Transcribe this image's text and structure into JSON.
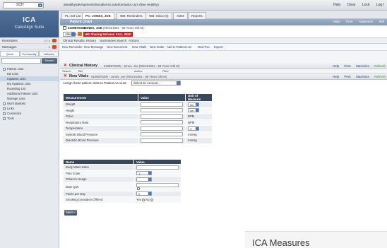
{
  "topbar": {
    "site_select": "SCH",
    "url": "ahealthy\\devlopment\\clinicalterms.icainformatics.com (Bee Healthy)",
    "links": [
      "Help",
      "Clear",
      "Lock",
      "Log I"
    ]
  },
  "sidebar": {
    "logo": "ICA",
    "suite": "CareAlign Suite",
    "rows": [
      {
        "label": "Reminders",
        "count": "0 / 0"
      },
      {
        "label": "Messages",
        "count": "0"
      }
    ],
    "tabs": [
      "Quick",
      "Community",
      "Network"
    ],
    "search_btn": "Search",
    "tree": [
      {
        "label": "Patient Lists",
        "sub": false,
        "selected": false
      },
      {
        "label": "ED Lists",
        "sub": true,
        "selected": false
      },
      {
        "label": "Inpatient Lists",
        "sub": true,
        "selected": true
      },
      {
        "label": "My Inpatient Lists",
        "sub": true,
        "selected": false
      },
      {
        "label": "Rounding List",
        "sub": true,
        "selected": false
      },
      {
        "label": "Additional Patient Lists",
        "sub": true,
        "selected": false
      },
      {
        "label": "Manage Lists",
        "sub": true,
        "selected": false
      },
      {
        "label": "Work Baskets",
        "sub": false,
        "selected": false
      },
      {
        "label": "Links",
        "sub": false,
        "selected": false
      },
      {
        "label": "Customize",
        "sub": false,
        "selected": false
      },
      {
        "label": "Tools",
        "sub": false,
        "selected": false
      }
    ]
  },
  "main": {
    "tabs": [
      "PL: ED List",
      "PC: JONES, JOE",
      "WB: Reminders",
      "WB: Inbox (0)",
      "ADM:",
      "Reports"
    ],
    "patient_chart": {
      "title": "Patient Chart",
      "links": [
        "Help",
        "Print",
        "Maximize",
        "Ref"
      ]
    },
    "patient": {
      "mrn": "5109870205",
      "name": "JONES, JOE",
      "dob": "(09/24/1951 - 58 Years Old M)"
    },
    "alerts": {
      "select": "Allergies",
      "badges": [
        "HIE Sharing Refused",
        "FALL RISK"
      ]
    },
    "subtabs": [
      "Clinical Results",
      "History",
      "Summaries",
      "Search",
      "Actions"
    ],
    "actions": [
      "New Reminder",
      "New Message",
      "New Document",
      "New Vitals",
      "New Order",
      "Add to Patient List",
      "Med Rec",
      "Export"
    ],
    "clinical_history": {
      "title": "Clinical History",
      "subtitle": "5109870205 - Jones, Joe (09/24/1951 - 58 Years Old M)",
      "links": [
        "Help",
        "Print",
        "Maximize",
        "Refresh"
      ],
      "cols": [
        "Search",
        "Title",
        "Author",
        "Filter"
      ]
    },
    "new_vitals": {
      "title": "New Vitals",
      "subtitle": "5109870205 - Jones, Joe (09/24/1951 - 58 Years Old M)",
      "links": [
        "Help",
        "Print",
        "Maximize",
        "Refresh"
      ],
      "assign_label": "Assign these patient vitals to Patient Account:",
      "assign_select": "Select an Account..."
    },
    "measurements": {
      "headers": [
        "Measurement",
        "Value",
        "Unit of Measure"
      ],
      "rows": [
        {
          "name": "Weight",
          "unit": "lbs",
          "unit_dd": true
        },
        {
          "name": "Height",
          "unit": "cm",
          "unit_dd": true
        },
        {
          "name": "Pulse",
          "unit": "BPM",
          "unit_dd": false
        },
        {
          "name": "Respiratory Rate",
          "unit": "BPM",
          "unit_dd": false
        },
        {
          "name": "Temperature",
          "unit": "C",
          "unit_dd": true
        },
        {
          "name": "Systolic Blood Pressure",
          "unit": "mmHg",
          "unit_dd": false
        },
        {
          "name": "Diastolic Blood Pressure",
          "unit": "mmHg",
          "unit_dd": false
        }
      ]
    },
    "other": {
      "headers": [
        "Name",
        "Value"
      ],
      "rows": [
        {
          "name": "Body Mass Index",
          "kind": "text",
          "value": ""
        },
        {
          "name": "Pain Scale",
          "kind": "select",
          "value": "1"
        },
        {
          "name": "Tobacco Usage",
          "kind": "select",
          "value": ""
        },
        {
          "name": "Date Quit",
          "kind": "date",
          "value": ""
        },
        {
          "name": "Packs per Day",
          "kind": "select",
          "value": "0"
        },
        {
          "name": "Smoking Cessation Offered",
          "kind": "radio",
          "value": "Yes / No"
        }
      ],
      "radio_yes": "Yes",
      "radio_no": "No"
    },
    "next_button": "Next »",
    "measures_caption": "ICA Measures"
  },
  "colors": {
    "header_bar": "#8197b5",
    "table_header": "#39475a",
    "alert_red": "#cc1d1d",
    "logo_bg": "#3b5a83"
  }
}
